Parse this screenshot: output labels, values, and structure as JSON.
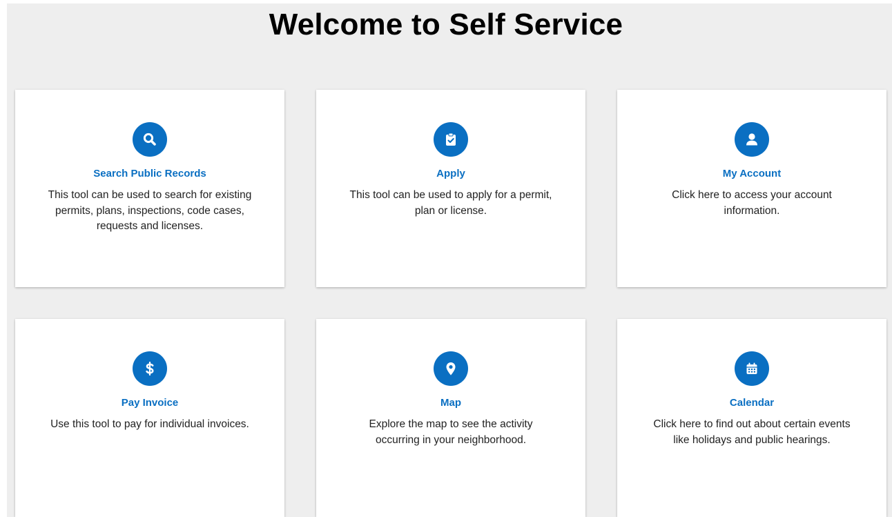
{
  "page": {
    "title": "Welcome to Self Service"
  },
  "colors": {
    "background": "#eeeeee",
    "card": "#ffffff",
    "accent": "#0a6fc2",
    "text": "#222222"
  },
  "cards": [
    {
      "icon": "search-icon",
      "title": "Search Public Records",
      "description": "This tool can be used to search for existing permits, plans, inspections, code cases, requests and licenses."
    },
    {
      "icon": "clipboard-check-icon",
      "title": "Apply",
      "description": "This tool can be used to apply for a permit, plan or license."
    },
    {
      "icon": "user-icon",
      "title": "My Account",
      "description": "Click here to access your account information."
    },
    {
      "icon": "dollar-icon",
      "title": "Pay Invoice",
      "description": "Use this tool to pay for individual invoices."
    },
    {
      "icon": "map-pin-icon",
      "title": "Map",
      "description": "Explore the map to see the activity occurring in your neighborhood."
    },
    {
      "icon": "calendar-icon",
      "title": "Calendar",
      "description": "Click here to find out about certain events like holidays and public hearings."
    }
  ]
}
